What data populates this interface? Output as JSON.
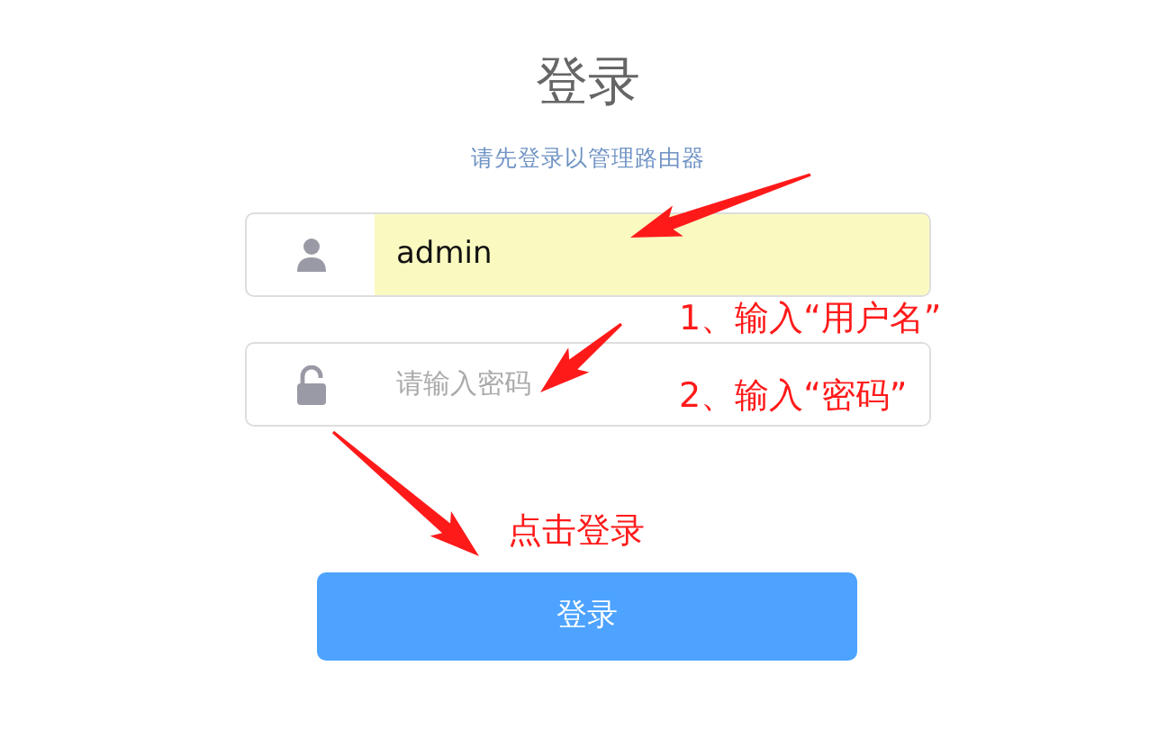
{
  "title": "登录",
  "subtitle": "请先登录以管理路由器",
  "fields": [
    {
      "kind": "user",
      "value": "admin",
      "autofilled": true
    },
    {
      "kind": "password",
      "placeholder": "请输入密码",
      "autofilled": false
    }
  ],
  "login_button": "登录",
  "annotations": [
    {
      "text": "1、输入“用户名”"
    },
    {
      "text": "2、输入“密码”"
    },
    {
      "text": "点击登录"
    }
  ]
}
